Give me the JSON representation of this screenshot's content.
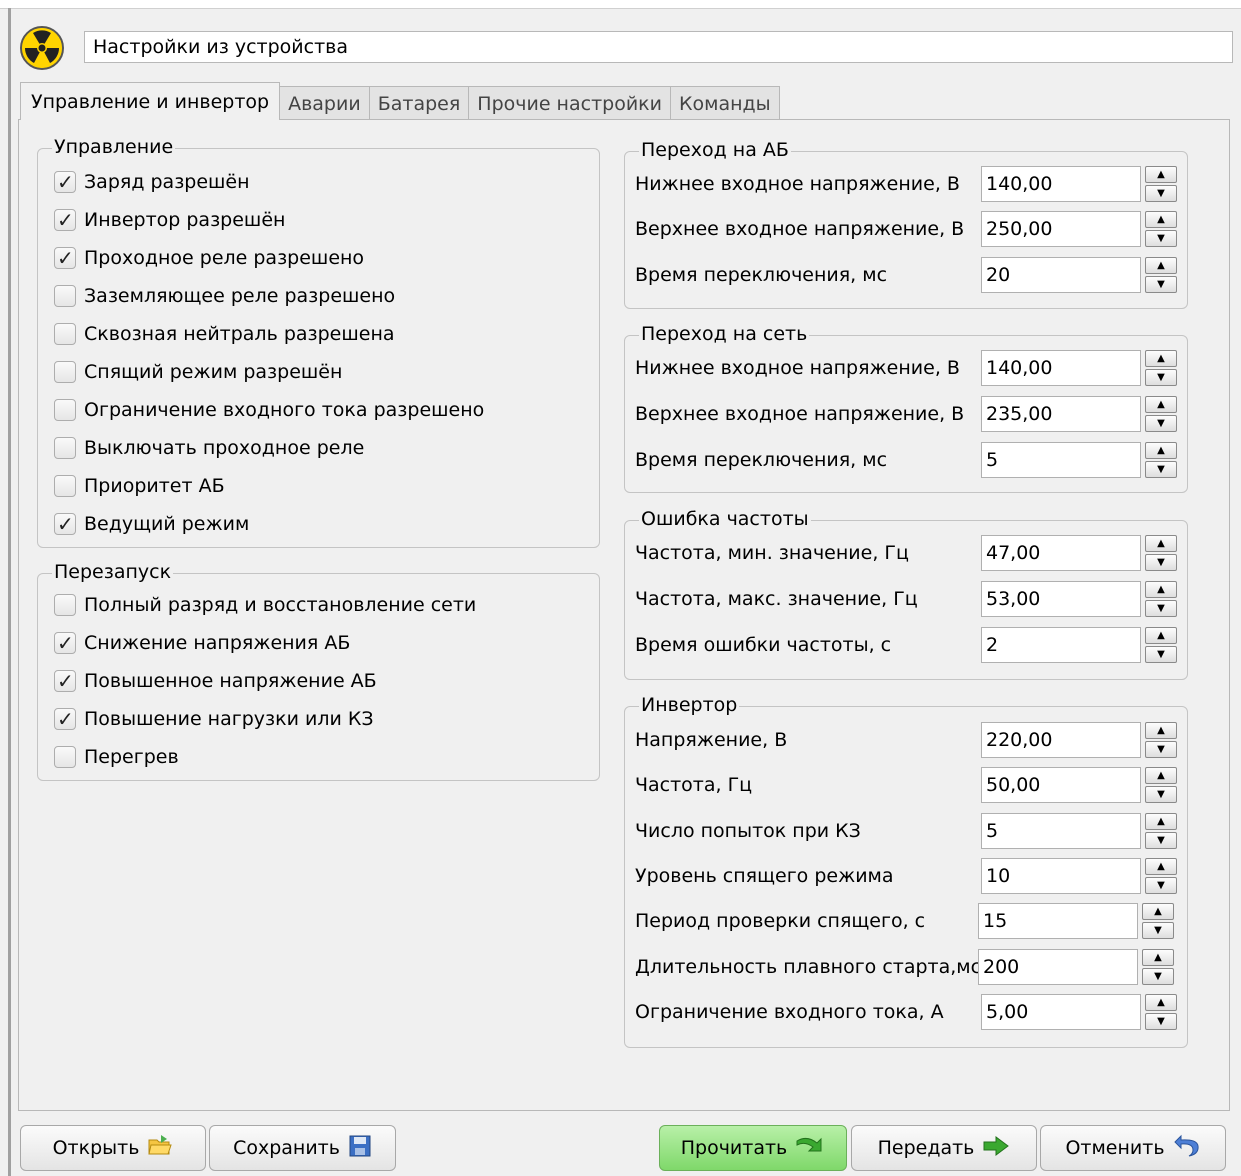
{
  "window": {
    "title_field": "Настройки из устройства"
  },
  "tabs": [
    {
      "label": "Управление и инвертор",
      "active": true
    },
    {
      "label": "Аварии"
    },
    {
      "label": "Батарея"
    },
    {
      "label": "Прочие настройки"
    },
    {
      "label": "Команды"
    }
  ],
  "control": {
    "title": "Управление",
    "items": [
      {
        "label": "Заряд разрешён",
        "checked": true
      },
      {
        "label": "Инвертор разрешён",
        "checked": true
      },
      {
        "label": "Проходное реле разрешено",
        "checked": true
      },
      {
        "label": "Заземляющее реле разрешено",
        "checked": false
      },
      {
        "label": "Сквозная нейтраль разрешена",
        "checked": false
      },
      {
        "label": "Спящий режим разрешён",
        "checked": false
      },
      {
        "label": "Ограничение входного тока разрешено",
        "checked": false
      },
      {
        "label": "Выключать проходное реле",
        "checked": false
      },
      {
        "label": "Приоритет АБ",
        "checked": false
      },
      {
        "label": "Ведущий режим",
        "checked": true
      }
    ]
  },
  "restart": {
    "title": "Перезапуск",
    "items": [
      {
        "label": "Полный разряд и восстановление сети",
        "checked": false
      },
      {
        "label": "Снижение напряжения АБ",
        "checked": true
      },
      {
        "label": "Повышенное напряжение АБ",
        "checked": true
      },
      {
        "label": "Повышение нагрузки или КЗ",
        "checked": true
      },
      {
        "label": "Перегрев",
        "checked": false
      }
    ]
  },
  "battery_switch": {
    "title": "Переход на АБ",
    "fields": [
      {
        "label": "Нижнее входное напряжение, В",
        "value": "140,00"
      },
      {
        "label": "Верхнее входное напряжение, В",
        "value": "250,00"
      },
      {
        "label": "Время переключения, мс",
        "value": "20"
      }
    ]
  },
  "grid_switch": {
    "title": "Переход на сеть",
    "fields": [
      {
        "label": "Нижнее входное напряжение, В",
        "value": "140,00"
      },
      {
        "label": "Верхнее входное напряжение, В",
        "value": "235,00"
      },
      {
        "label": "Время переключения, мс",
        "value": "5"
      }
    ]
  },
  "freq_error": {
    "title": "Ошибка частоты",
    "fields": [
      {
        "label": "Частота, мин. значение, Гц",
        "value": "47,00"
      },
      {
        "label": "Частота, макс. значение, Гц",
        "value": "53,00"
      },
      {
        "label": "Время ошибки частоты, с",
        "value": "2"
      }
    ]
  },
  "inverter": {
    "title": "Инвертор",
    "fields": [
      {
        "label": "Напряжение, В",
        "value": "220,00"
      },
      {
        "label": "Частота, Гц",
        "value": "50,00"
      },
      {
        "label": "Число попыток при КЗ",
        "value": "5"
      },
      {
        "label": "Уровень спящего режима",
        "value": "10"
      },
      {
        "label": "Период проверки спящего, с",
        "value": "15"
      },
      {
        "label": "Длительность плавного старта,мс",
        "value": "200"
      },
      {
        "label": "Ограничение входного тока, А",
        "value": "5,00"
      }
    ]
  },
  "buttons": {
    "open": "Открыть",
    "save": "Сохранить",
    "read": "Прочитать",
    "send": "Передать",
    "cancel": "Отменить"
  },
  "icons": {
    "logo": "radiation-icon",
    "open": "folder-open-icon",
    "save": "floppy-disk-icon",
    "read": "green-arrow-in-icon",
    "send": "green-arrow-right-icon",
    "cancel": "undo-arrow-icon"
  },
  "colors": {
    "read_button": "#8fe07a",
    "logo_yellow": "#ffd400"
  }
}
